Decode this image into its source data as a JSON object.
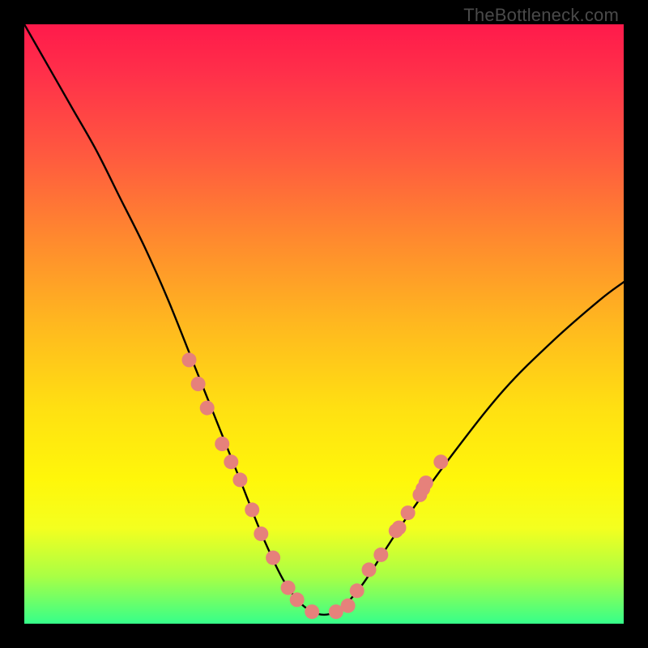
{
  "watermark": {
    "text": "TheBottleneck.com"
  },
  "chart_data": {
    "type": "line",
    "title": "",
    "xlabel": "",
    "ylabel": "",
    "xlim": [
      0,
      1
    ],
    "ylim": [
      0,
      1
    ],
    "series": [
      {
        "name": "bottleneck-curve",
        "x": [
          0.0,
          0.04,
          0.08,
          0.12,
          0.16,
          0.2,
          0.24,
          0.28,
          0.32,
          0.36,
          0.4,
          0.44,
          0.48,
          0.52,
          0.56,
          0.6,
          0.64,
          0.72,
          0.8,
          0.88,
          0.96,
          1.0
        ],
        "values": [
          1.0,
          0.93,
          0.86,
          0.79,
          0.71,
          0.63,
          0.54,
          0.44,
          0.34,
          0.24,
          0.14,
          0.06,
          0.02,
          0.02,
          0.06,
          0.12,
          0.18,
          0.29,
          0.39,
          0.47,
          0.54,
          0.57
        ]
      }
    ],
    "markers": {
      "name": "highlight-dots",
      "color": "#e6817b",
      "points": [
        {
          "x": 0.275,
          "y": 0.44
        },
        {
          "x": 0.29,
          "y": 0.4
        },
        {
          "x": 0.305,
          "y": 0.36
        },
        {
          "x": 0.33,
          "y": 0.3
        },
        {
          "x": 0.345,
          "y": 0.27
        },
        {
          "x": 0.36,
          "y": 0.24
        },
        {
          "x": 0.38,
          "y": 0.19
        },
        {
          "x": 0.395,
          "y": 0.15
        },
        {
          "x": 0.415,
          "y": 0.11
        },
        {
          "x": 0.44,
          "y": 0.06
        },
        {
          "x": 0.455,
          "y": 0.04
        },
        {
          "x": 0.48,
          "y": 0.02
        },
        {
          "x": 0.52,
          "y": 0.02
        },
        {
          "x": 0.54,
          "y": 0.03
        },
        {
          "x": 0.555,
          "y": 0.055
        },
        {
          "x": 0.575,
          "y": 0.09
        },
        {
          "x": 0.595,
          "y": 0.115
        },
        {
          "x": 0.62,
          "y": 0.155
        },
        {
          "x": 0.625,
          "y": 0.16
        },
        {
          "x": 0.64,
          "y": 0.185
        },
        {
          "x": 0.66,
          "y": 0.215
        },
        {
          "x": 0.665,
          "y": 0.225
        },
        {
          "x": 0.67,
          "y": 0.235
        },
        {
          "x": 0.695,
          "y": 0.27
        }
      ]
    },
    "gradient_stops": [
      {
        "pos": 0.0,
        "color": "#ff1a4b"
      },
      {
        "pos": 0.5,
        "color": "#ffe012"
      },
      {
        "pos": 1.0,
        "color": "#36ff8a"
      }
    ]
  }
}
